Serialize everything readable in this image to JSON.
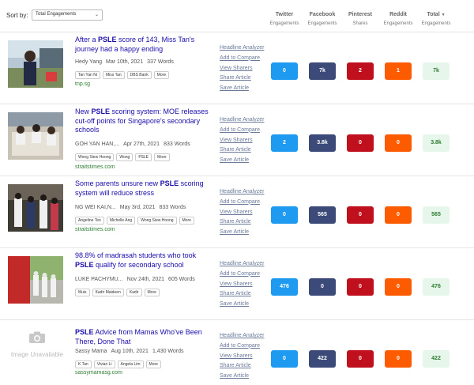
{
  "sort": {
    "label": "Sort by:",
    "selected": "Total Engagements"
  },
  "columns": [
    {
      "title": "Twitter",
      "sub": "Engagements"
    },
    {
      "title": "Facebook",
      "sub": "Engagements"
    },
    {
      "title": "Pinterest",
      "sub": "Shares"
    },
    {
      "title": "Reddit",
      "sub": "Engagements"
    },
    {
      "title": "Total",
      "sub": "Engagements",
      "sort_arrow": "▼"
    }
  ],
  "actions": [
    "Headline Analyzer",
    "Add to Compare",
    "View Sharers",
    "Share Article",
    "Save Article"
  ],
  "image_unavailable": "Image Unavailable",
  "articles": [
    {
      "title_pre": "After a ",
      "title_bold": "PSLE",
      "title_post": " score of 143, Miss Tan's journey had a happy ending",
      "author": "Hedy Yang",
      "date": "Mar 10th, 2021",
      "words": "337 Words",
      "tags": [
        "Tan Yan Ni",
        "Miss Tan",
        "DBS Bank",
        "More"
      ],
      "domain": "tnp.sg",
      "twitter": "0",
      "facebook": "7k",
      "pinterest": "2",
      "reddit": "1",
      "total": "7k"
    },
    {
      "title_pre": "New ",
      "title_bold": "PSLE",
      "title_post": " scoring system: MOE releases cut-off points for Singapore's secondary schools",
      "author": "GOH YAN HAN,...",
      "date": "Apr 27th, 2021",
      "words": "833 Words",
      "tags": [
        "Wong Siew Hoong",
        "Wong",
        "PSLE",
        "More"
      ],
      "domain": "straitstimes.com",
      "twitter": "2",
      "facebook": "3.8k",
      "pinterest": "0",
      "reddit": "0",
      "total": "3.8k"
    },
    {
      "title_pre": "Some parents unsure new ",
      "title_bold": "PSLE",
      "title_post": " scoring system will reduce stress",
      "author": "NG WEI KAI,N...",
      "date": "May 3rd, 2021",
      "words": "833 Words",
      "tags": [
        "Angeline Teo",
        "Michelle Ang",
        "Wong Siew Hoong",
        "More"
      ],
      "domain": "straitstimes.com",
      "twitter": "0",
      "facebook": "565",
      "pinterest": "0",
      "reddit": "0",
      "total": "565"
    },
    {
      "title_pre": "98.8% of madrasah students who took ",
      "title_bold": "PSLE",
      "title_post": " qualify for secondary school",
      "author": "LUKE PACHYMU...",
      "date": "Nov 24th, 2021",
      "words": "605 Words",
      "tags": [
        "Muis",
        "Kadir Maideen",
        "Kadir",
        "More"
      ],
      "domain": "straitstimes.com",
      "twitter": "476",
      "facebook": "0",
      "pinterest": "0",
      "reddit": "0",
      "total": "476"
    },
    {
      "title_pre": "",
      "title_bold": "PSLE",
      "title_post": " Advice from Mamas Who've Been There, Done That",
      "author": "Sassy Mama",
      "date": "Aug 10th, 2021",
      "words": "1,430 Words",
      "tags": [
        "K Tan",
        "Vivian Li",
        "Angela Lim",
        "More"
      ],
      "domain": "sassymamasg.com",
      "twitter": "0",
      "facebook": "422",
      "pinterest": "0",
      "reddit": "0",
      "total": "422"
    }
  ]
}
